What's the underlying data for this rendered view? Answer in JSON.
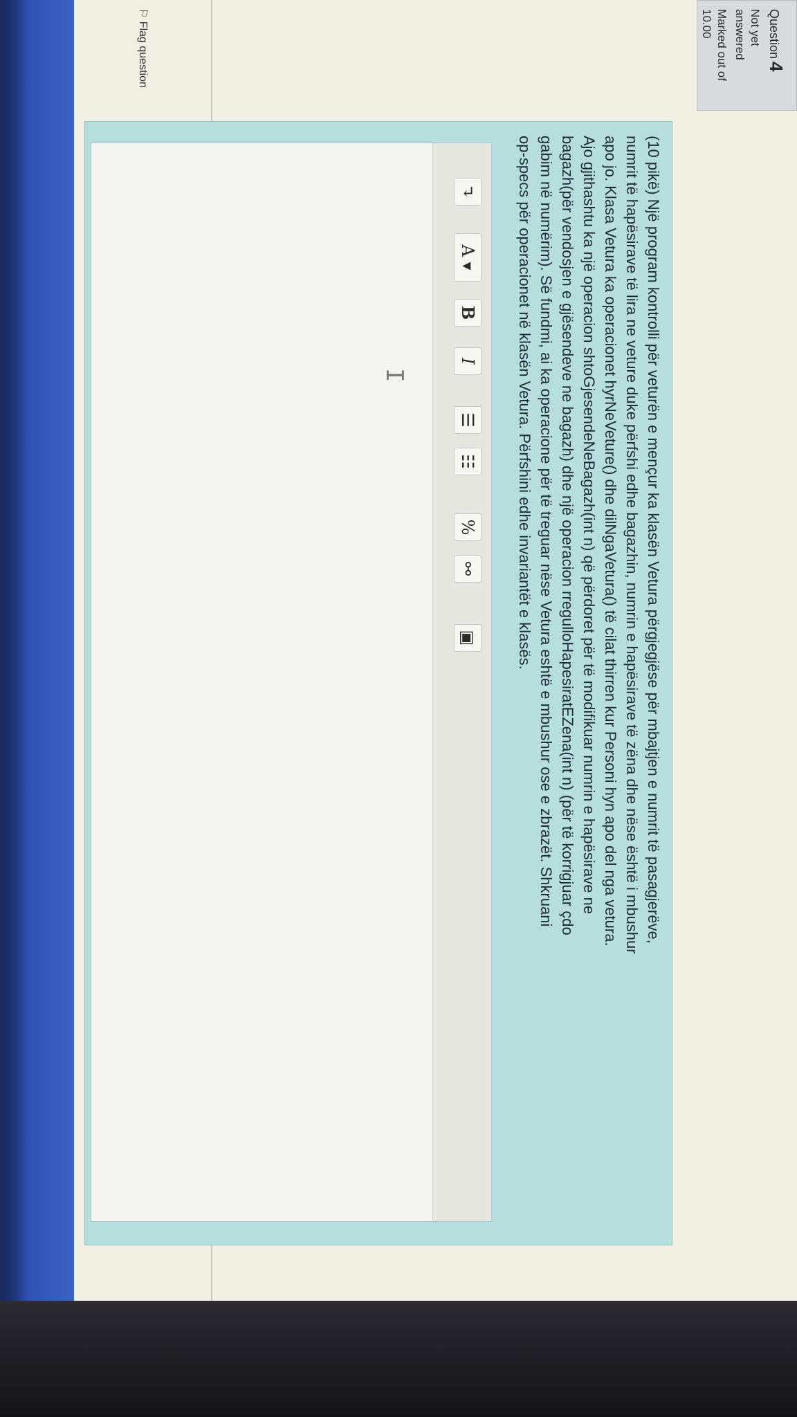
{
  "question": {
    "label": "Question",
    "number": "4",
    "status_line1": "Not yet",
    "status_line2": "answered",
    "marked_line1": "Marked out of",
    "marked_line2": "10.00",
    "flag_label": "Flag question"
  },
  "text_lines": [
    "(10 pikë) Një program kontrolli për veturën e mençur ka klasën Vetura përgjegjëse për mbajtjen e numrit të pasagjerëve,",
    "numrit të hapësirave të lira ne veture duke përfshi edhe bagazhin, numrin e hapësirave të zëna dhe nëse është i mbushur",
    "apo jo. Klasa Vetura ka operacionet hyrNeVeture() dhe dilNgaVetura() të cilat thirren kur Personi hyn apo del nga vetura.",
    "Ajo gjithashtu ka një operacion shtoGjesendeNeBagazh(int n) që përdoret për të modifikuar numrin e hapësirave ne",
    "bagazh(për vendosjen e gjësendeve ne bagazh) dhe një operacion rregulloHapesiratEZena(int n) (për të korrigjuar çdo",
    "gabim në numërim). Së fundmi, ai ka operacione për të treguar nëse Vetura eshtë e mbushur ose e zbrazët. Shkruani",
    "op-specs për operacionet në klasën Vetura. Përfshini edhe invariantët e klasës."
  ],
  "toolbar": {
    "expand": "↴",
    "font_color": "A ▾",
    "bold": "B",
    "italic": "I",
    "unordered_list": "☰",
    "ordered_list": "☷",
    "link": "%",
    "unlink": "⚯",
    "image": "▣"
  },
  "editor": {
    "cursor": "I"
  }
}
